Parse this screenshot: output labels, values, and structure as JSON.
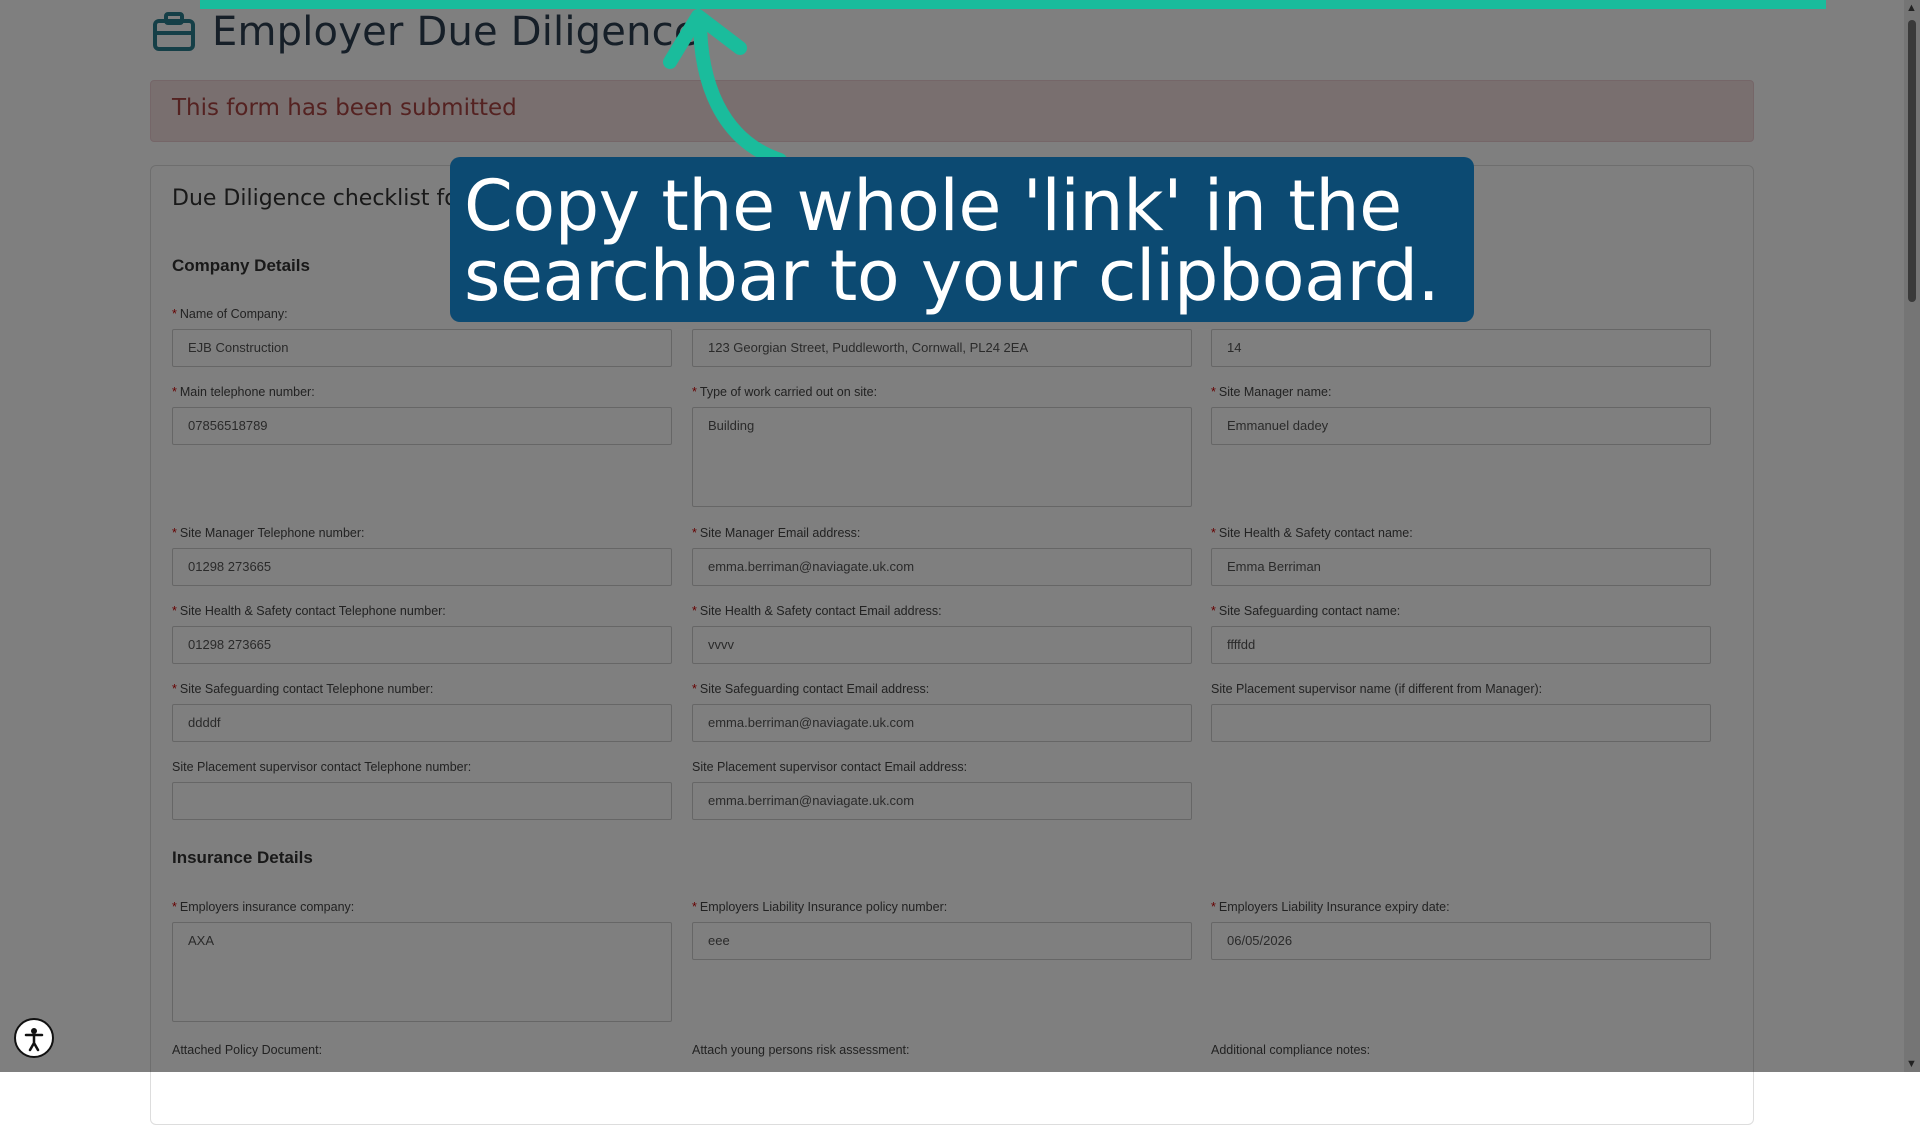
{
  "page": {
    "title": "Employer Due Diligence",
    "alert": "This form has been submitted",
    "panel_heading": "Due Diligence checklist for "
  },
  "sections": {
    "company": "Company Details",
    "insurance": "Insurance Details"
  },
  "company_fields": [
    {
      "label": "Name of Company:",
      "value": "EJB Construction",
      "required": true
    },
    {
      "label": "",
      "value": "123 Georgian Street, Puddleworth, Cornwall, PL24 2EA",
      "required": false
    },
    {
      "label": "",
      "value": "14",
      "required": false
    },
    {
      "label": "Main telephone number:",
      "value": "07856518789",
      "required": true
    },
    {
      "label": "Type of work carried out on site:",
      "value": "Building",
      "required": true
    },
    {
      "label": "Site Manager name:",
      "value": "Emmanuel dadey",
      "required": true
    },
    {
      "label": "Site Manager Telephone number:",
      "value": "01298 273665",
      "required": true
    },
    {
      "label": "Site Manager Email address:",
      "value": "emma.berriman@naviagate.uk.com",
      "required": true
    },
    {
      "label": "Site Health & Safety contact name:",
      "value": "Emma Berriman",
      "required": true
    },
    {
      "label": "Site Health & Safety contact Telephone number:",
      "value": "01298 273665",
      "required": true
    },
    {
      "label": "Site Health & Safety contact Email address:",
      "value": "vvvv",
      "required": true
    },
    {
      "label": "Site Safeguarding contact name:",
      "value": "ffffdd",
      "required": true
    },
    {
      "label": "Site Safeguarding contact Telephone number:",
      "value": "ddddf",
      "required": true
    },
    {
      "label": "Site Safeguarding contact Email address:",
      "value": "emma.berriman@naviagate.uk.com",
      "required": true
    },
    {
      "label": "Site Placement supervisor name (if different from Manager):",
      "value": "",
      "required": false
    },
    {
      "label": "Site Placement supervisor contact Telephone number:",
      "value": "",
      "required": false
    },
    {
      "label": "Site Placement supervisor contact Email address:",
      "value": "emma.berriman@naviagate.uk.com",
      "required": false
    }
  ],
  "insurance_fields": [
    {
      "label": "Employers insurance company:",
      "value": "AXA",
      "required": true
    },
    {
      "label": "Employers Liability Insurance policy number:",
      "value": "eee",
      "required": true
    },
    {
      "label": "Employers Liability Insurance expiry date:",
      "value": "06/05/2026",
      "required": true
    }
  ],
  "bottom_labels": {
    "policy_doc": "Attached Policy Document:",
    "risk": "Attach young persons risk assessment:",
    "notes": "Additional compliance notes:"
  },
  "callout": {
    "line1": "Copy the whole 'link' in the",
    "line2": "searchbar to your clipboard."
  },
  "colors": {
    "callout_bg": "#0c4a72",
    "accent_teal": "#1abc9c",
    "alert_text": "#a94442",
    "required_star": "#cc0000"
  },
  "icons": [
    "briefcase-icon",
    "accessibility-icon",
    "arrow-icon"
  ]
}
